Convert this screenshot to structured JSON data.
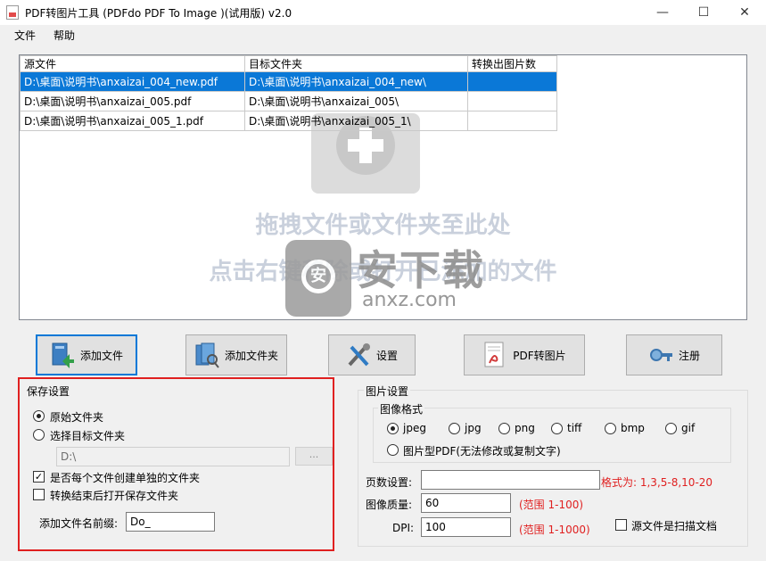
{
  "window": {
    "title": "PDF转图片工具 (PDFdo PDF To Image )(试用版) v2.0",
    "minimize": "—",
    "maximize": "☐",
    "close": "✕"
  },
  "menu": [
    "文件",
    "帮助"
  ],
  "table": {
    "headers": [
      "源文件",
      "目标文件夹",
      "转换出图片数"
    ],
    "rows": [
      [
        "D:\\桌面\\说明书\\anxaizai_004_new.pdf",
        "D:\\桌面\\说明书\\anxaizai_004_new\\",
        ""
      ],
      [
        "D:\\桌面\\说明书\\anxaizai_005.pdf",
        "D:\\桌面\\说明书\\anxaizai_005\\",
        ""
      ],
      [
        "D:\\桌面\\说明书\\anxaizai_005_1.pdf",
        "D:\\桌面\\说明书\\anxaizai_005_1\\",
        ""
      ]
    ]
  },
  "drop_hint": {
    "line1": "拖拽文件或文件夹至此处",
    "line2": "点击右键移除或打开已添加的文件"
  },
  "watermark": {
    "brand": "安下载",
    "domain": "anxz.com",
    "badge": "安"
  },
  "toolbar": {
    "add_file": "添加文件",
    "add_folder": "添加文件夹",
    "settings": "设置",
    "convert": "PDF转图片",
    "register": "注册"
  },
  "save_settings": {
    "title": "保存设置",
    "option_original": "原始文件夹",
    "option_target": "选择目标文件夹",
    "path_value": "D:\\",
    "browse_label": "...",
    "checkbox_separate": "是否每个文件创建单独的文件夹",
    "checkbox_open": "转换结束后打开保存文件夹",
    "prefix_label": "添加文件名前缀:",
    "prefix_value": "Do_"
  },
  "image_settings": {
    "title": "图片设置",
    "format_title": "图像格式",
    "formats": [
      "jpeg",
      "jpg",
      "png",
      "tiff",
      "bmp",
      "gif"
    ],
    "selected_format": "jpeg",
    "pdf_image_option": "图片型PDF(无法修改或复制文字)",
    "pages_label": "页数设置:",
    "pages_value": "",
    "pages_hint": "格式为: 1,3,5-8,10-20",
    "quality_label": "图像质量:",
    "quality_value": "60",
    "quality_hint": "(范围 1-100)",
    "dpi_label": "DPI:",
    "dpi_value": "100",
    "dpi_hint": "(范围 1-1000)",
    "scan_label": "源文件是扫描文档"
  },
  "colors": {
    "selection": "#0a78d7",
    "highlight_border": "#e02020",
    "hint_text": "#e02020"
  }
}
